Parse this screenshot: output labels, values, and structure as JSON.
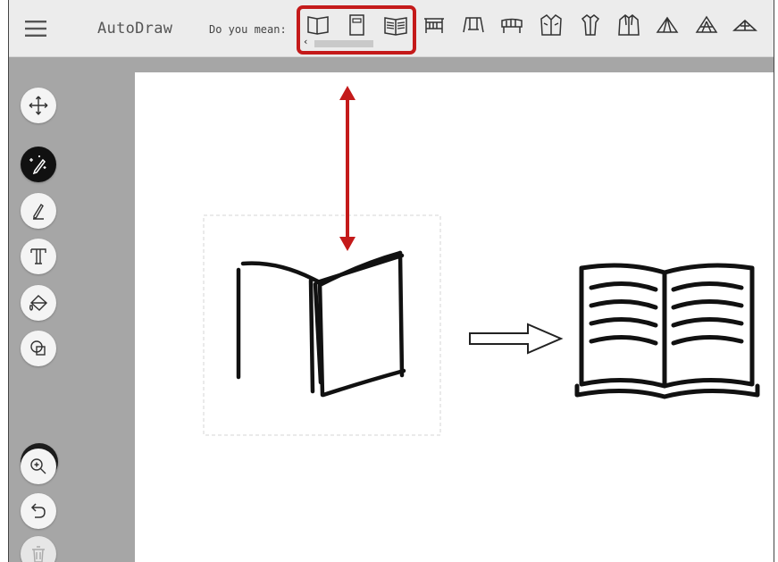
{
  "header": {
    "app_title": "AutoDraw",
    "suggestions_label": "Do you mean:",
    "suggestions": [
      "book-open",
      "book-closed",
      "book-lines",
      "crib",
      "swing",
      "bench",
      "jacket",
      "shirt",
      "coat",
      "tent",
      "tent-striped",
      "tent-low"
    ],
    "scroll_left_glyph": "‹"
  },
  "sidebar": {
    "tools": [
      "move-icon",
      "autodraw-icon",
      "pencil-icon",
      "text-icon",
      "fill-icon",
      "shape-icon"
    ],
    "active_tool": "autodraw-icon",
    "current_color": "#1c1c1c",
    "bottom_tools": [
      "zoom-in-icon",
      "undo-icon",
      "trash-icon"
    ]
  },
  "colors": {
    "annotation_red": "#c41a1a",
    "sidebar_gray": "#a6a6a6",
    "topbar_gray": "#ececec"
  }
}
